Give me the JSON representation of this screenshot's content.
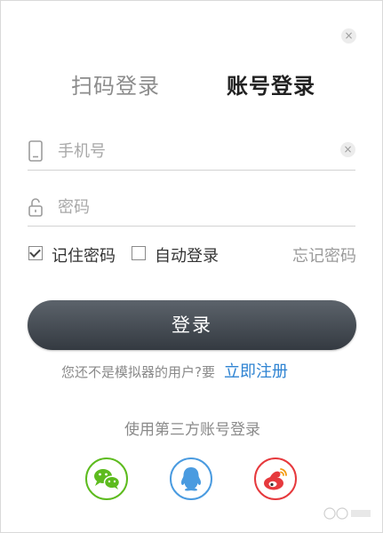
{
  "dialog": {
    "close_label": "×"
  },
  "tabs": [
    {
      "label": "扫码登录",
      "active": false
    },
    {
      "label": "账号登录",
      "active": true
    }
  ],
  "phone_field": {
    "placeholder": "手机号",
    "value": "",
    "icon": "phone-icon",
    "clear_label": "×"
  },
  "password_field": {
    "placeholder": "密码",
    "value": "",
    "icon": "lock-icon"
  },
  "options": {
    "remember": {
      "label": "记住密码",
      "checked": true
    },
    "auto_login": {
      "label": "自动登录",
      "checked": false
    },
    "forgot_label": "忘记密码"
  },
  "login_button": {
    "label": "登录"
  },
  "register": {
    "prompt": "您还不是模拟器的用户?要",
    "link_label": "立即注册"
  },
  "third_party": {
    "title": "使用第三方账号登录",
    "providers": [
      {
        "name": "wechat",
        "icon": "wechat-icon",
        "color": "#5dbb1e"
      },
      {
        "name": "qq",
        "icon": "qq-icon",
        "color": "#4a9be0"
      },
      {
        "name": "weibo",
        "icon": "weibo-icon",
        "color": "#e6393d"
      }
    ]
  },
  "colors": {
    "accent_link": "#2e83d2",
    "button_dark": "#3f454c",
    "divider": "#d2d2d2"
  }
}
